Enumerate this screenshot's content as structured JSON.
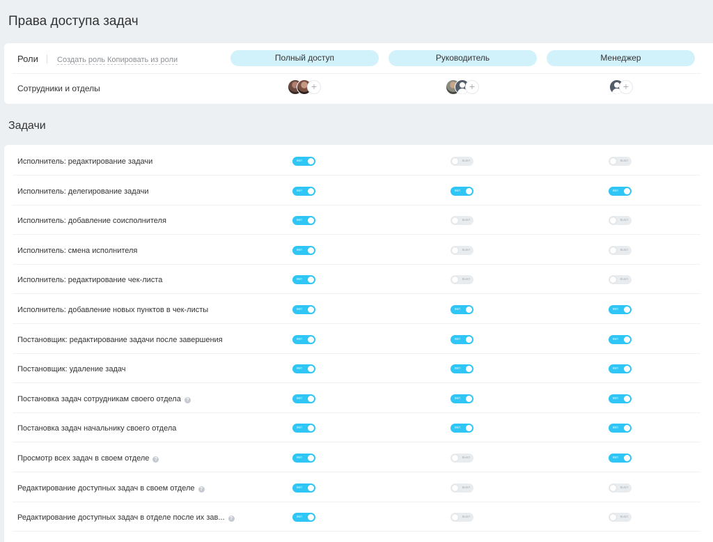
{
  "page": {
    "title": "Права доступа задач"
  },
  "roles": {
    "label": "Роли",
    "create_link": "Создать роль",
    "copy_link": "Копировать из роли",
    "columns": [
      {
        "name": "Полный доступ"
      },
      {
        "name": "Руководитель"
      },
      {
        "name": "Менеджер"
      }
    ],
    "members_label": "Сотрудники и отделы",
    "add_symbol": "+"
  },
  "tasks": {
    "section_title": "Задачи",
    "toggle_on_text": "вкл",
    "toggle_off_text": "выкл",
    "help_symbol": "?",
    "rows": [
      {
        "label": "Исполнитель: редактирование задачи",
        "help": false,
        "values": [
          true,
          false,
          false
        ]
      },
      {
        "label": "Исполнитель: делегирование задачи",
        "help": false,
        "values": [
          true,
          true,
          true
        ]
      },
      {
        "label": "Исполнитель: добавление соисполнителя",
        "help": false,
        "values": [
          true,
          false,
          false
        ]
      },
      {
        "label": "Исполнитель: смена исполнителя",
        "help": false,
        "values": [
          true,
          false,
          false
        ]
      },
      {
        "label": "Исполнитель: редактирование чек-листа",
        "help": false,
        "values": [
          true,
          false,
          false
        ]
      },
      {
        "label": "Исполнитель: добавление новых пунктов в чек-листы",
        "help": false,
        "values": [
          true,
          true,
          true
        ]
      },
      {
        "label": "Постановщик: редактирование задачи после завершения",
        "help": false,
        "values": [
          true,
          true,
          true
        ]
      },
      {
        "label": "Постановщик: удаление задач",
        "help": false,
        "values": [
          true,
          true,
          true
        ]
      },
      {
        "label": "Постановка задач сотрудникам своего отдела",
        "help": true,
        "values": [
          true,
          true,
          true
        ]
      },
      {
        "label": "Постановка задач начальнику своего отдела",
        "help": false,
        "values": [
          true,
          true,
          true
        ]
      },
      {
        "label": "Просмотр всех задач в своем отделе",
        "help": true,
        "values": [
          true,
          false,
          true
        ]
      },
      {
        "label": "Редактирование доступных задач в своем отделе",
        "help": true,
        "values": [
          true,
          false,
          false
        ]
      },
      {
        "label": "Редактирование доступных задач в отделе после их зав...",
        "help": true,
        "values": [
          true,
          false,
          false
        ]
      }
    ]
  },
  "colors": {
    "toggle_on": "#2fc6f6",
    "toggle_off": "#e9ecef",
    "role_pill": "#d1f1fb",
    "page_bg": "#edf0f3"
  }
}
